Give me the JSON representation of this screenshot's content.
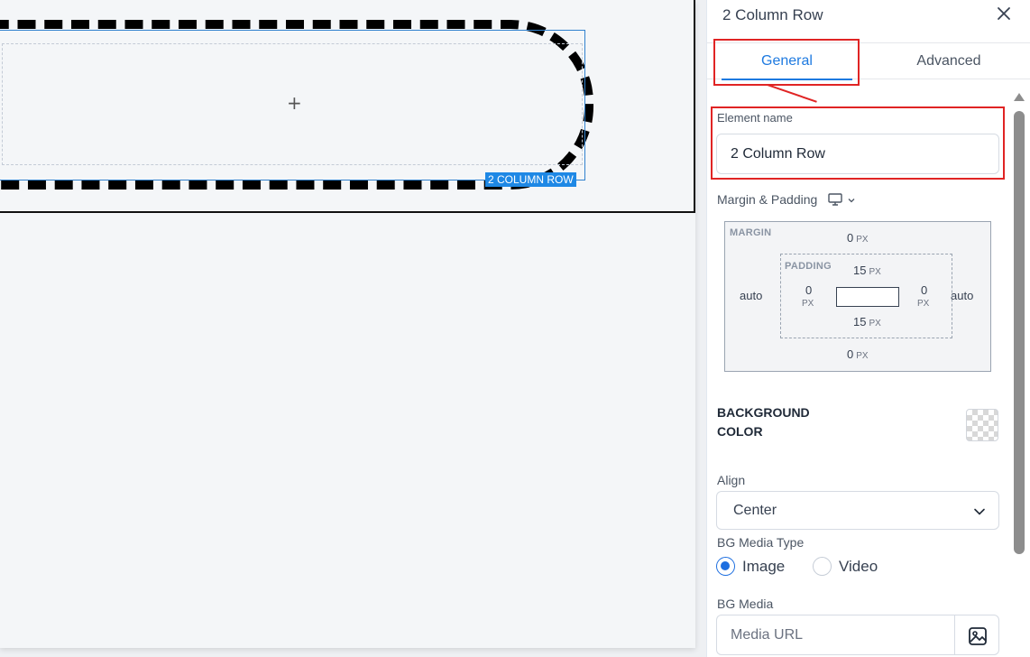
{
  "canvas": {
    "row_tag": "2 COLUMN ROW",
    "add_symbol": "+"
  },
  "panel": {
    "title": "2 Column Row",
    "tabs": [
      {
        "label": "General",
        "active": true
      },
      {
        "label": "Advanced",
        "active": false
      }
    ],
    "element_name": {
      "label": "Element name",
      "value": "2 Column Row"
    },
    "margin_padding": {
      "label": "Margin & Padding",
      "margin_caption": "MARGIN",
      "padding_caption": "PADDING",
      "margin": {
        "top": "0",
        "bottom": "0",
        "left": "auto",
        "right": "auto"
      },
      "padding": {
        "top": "15",
        "bottom": "15",
        "left": "0",
        "right": "0"
      },
      "unit": "PX"
    },
    "background": {
      "label_line1": "BACKGROUND",
      "label_line2": "COLOR"
    },
    "align": {
      "label": "Align",
      "value": "Center"
    },
    "bg_media_type": {
      "label": "BG Media Type",
      "options": [
        {
          "label": "Image",
          "checked": true
        },
        {
          "label": "Video",
          "checked": false
        }
      ]
    },
    "bg_media": {
      "label": "BG Media",
      "placeholder": "Media URL"
    }
  },
  "colors": {
    "accent": "#1e7ae0",
    "highlight": "#e02424",
    "row_tag_bg": "#1e88e5"
  }
}
